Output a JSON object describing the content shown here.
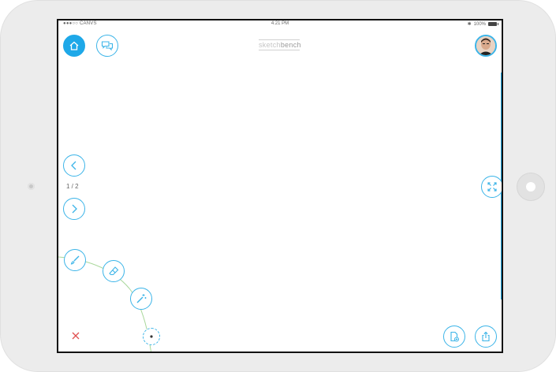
{
  "status_bar": {
    "carrier": "●●●○○ CANVS",
    "time": "4:21 PM",
    "battery": "100%"
  },
  "logo": {
    "part1": "sketch",
    "part2": "bench"
  },
  "page_indicator": "1 / 2",
  "icons": {
    "home": "home-icon",
    "chat": "chat-bubbles-icon",
    "prev": "chevron-left-icon",
    "next": "chevron-right-icon",
    "fullscreen": "expand-arrows-icon",
    "brush": "brush-icon",
    "eraser": "eraser-icon",
    "magic": "magic-wand-icon",
    "dot": "brush-size-dot-icon",
    "close": "close-icon",
    "new_page": "new-page-icon",
    "share": "share-icon"
  },
  "colors": {
    "accent": "#1ea8e8",
    "close": "#e05050",
    "arc": "#a8d79a"
  }
}
